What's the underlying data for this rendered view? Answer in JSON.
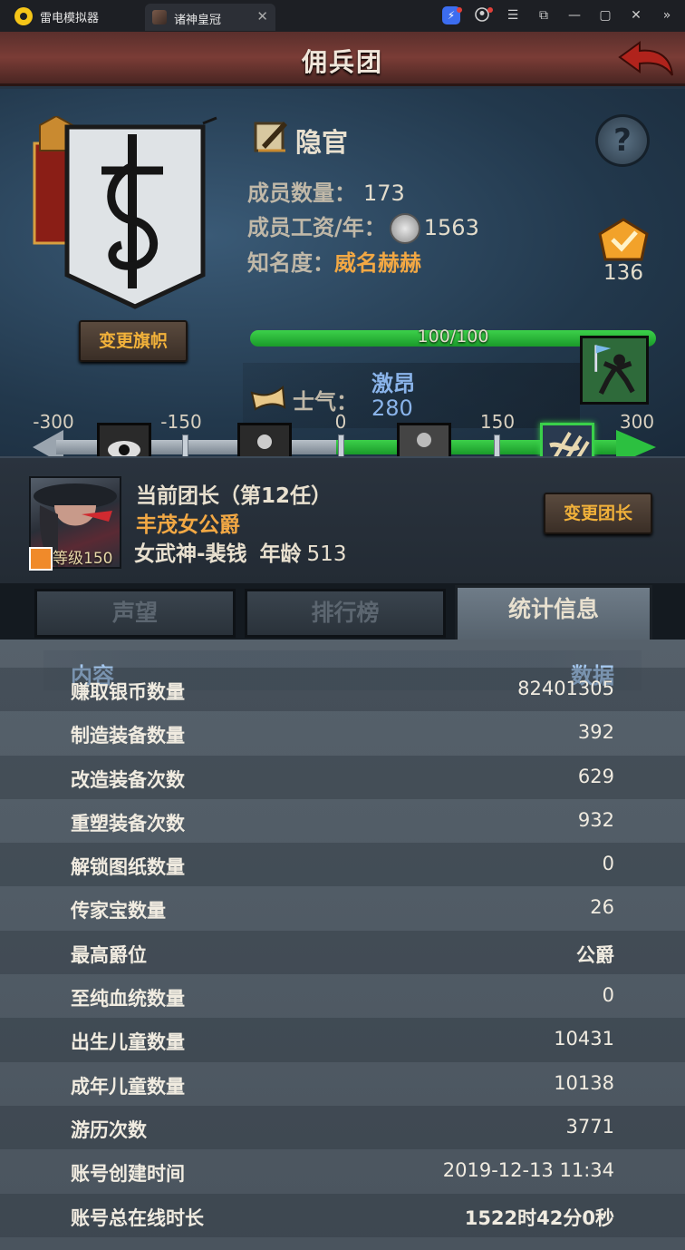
{
  "emulator": {
    "app_name": "雷电模拟器",
    "tab_title": "诸神皇冠",
    "tab_close": "✕",
    "controls": [
      "☰",
      "⧉",
      "—",
      "▢",
      "✕",
      "»"
    ]
  },
  "header": {
    "title": "佣兵团"
  },
  "guild": {
    "rank_name": "隐官",
    "help_symbol": "?",
    "member_count_label": "成员数量：",
    "member_count": "173",
    "salary_label": "成员工资/年：",
    "salary": "1563",
    "fame_label": "知名度：",
    "fame_value": "威名赫赫",
    "fame_bar_text": "100/100",
    "fame_progress": 1.0,
    "badge_value": "136",
    "change_flag_label": "变更旗帜"
  },
  "morale": {
    "label": "士气：",
    "state": "激昂",
    "value": "280",
    "scale_labels": [
      "-300",
      "-150",
      "0",
      "150",
      "300"
    ],
    "scale_min": -300,
    "scale_max": 300,
    "current": 280
  },
  "leader": {
    "title": "当前团长（第12任）",
    "name": "丰茂女公爵",
    "level_label": "等级",
    "level": "150",
    "class_name": "女武神-裴钱",
    "age_label": "年龄",
    "age": "513",
    "change_leader_label": "变更团长"
  },
  "tabs": [
    {
      "label": "声望",
      "active": false
    },
    {
      "label": "排行榜",
      "active": false
    },
    {
      "label": "统计信息",
      "active": true
    }
  ],
  "stats": {
    "header_label": "内容",
    "header_value": "数据",
    "rows": [
      {
        "label": "赚取银币数量",
        "value": "82401305"
      },
      {
        "label": "制造装备数量",
        "value": "392"
      },
      {
        "label": "改造装备次数",
        "value": "629"
      },
      {
        "label": "重塑装备次数",
        "value": "932"
      },
      {
        "label": "解锁图纸数量",
        "value": "0"
      },
      {
        "label": "传家宝数量",
        "value": "26"
      },
      {
        "label": "最高爵位",
        "value": "公爵"
      },
      {
        "label": "至纯血统数量",
        "value": "0"
      },
      {
        "label": "出生儿童数量",
        "value": "10431"
      },
      {
        "label": "成年儿童数量",
        "value": "10138"
      },
      {
        "label": "游历次数",
        "value": "3771"
      },
      {
        "label": "账号创建时间",
        "value": "2019-12-13 11:34"
      },
      {
        "label": "账号总在线时长",
        "value": "1522时42分0秒"
      }
    ]
  }
}
